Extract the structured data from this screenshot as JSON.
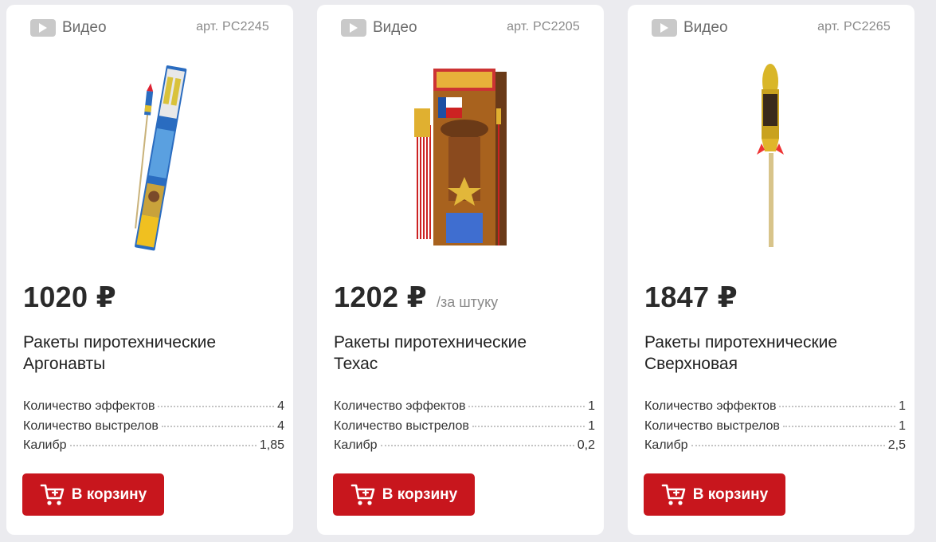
{
  "colors": {
    "background": "#ebebef",
    "card": "#ffffff",
    "cart_button": "#c8161d",
    "muted_text": "#8a8a8a"
  },
  "products": [
    {
      "video_label": "Видео",
      "article": "арт. PC2245",
      "price": "1020 ₽",
      "unit": "",
      "title_line1": "Ракеты пиротехнические",
      "title_line2": "Аргонавты",
      "specs": [
        {
          "label": "Количество эффектов",
          "value": "4"
        },
        {
          "label": "Количество выстрелов",
          "value": "4"
        },
        {
          "label": "Калибр",
          "value": "1,85"
        }
      ],
      "cart_label": "В корзину"
    },
    {
      "video_label": "Видео",
      "article": "арт. PC2205",
      "price": "1202 ₽",
      "unit": "/за штуку",
      "title_line1": "Ракеты пиротехнические",
      "title_line2": "Техас",
      "specs": [
        {
          "label": "Количество эффектов",
          "value": "1"
        },
        {
          "label": "Количество выстрелов",
          "value": "1"
        },
        {
          "label": "Калибр",
          "value": "0,2"
        }
      ],
      "cart_label": "В корзину"
    },
    {
      "video_label": "Видео",
      "article": "арт. PC2265",
      "price": "1847 ₽",
      "unit": "",
      "title_line1": "Ракеты пиротехнические",
      "title_line2": "Сверхновая",
      "specs": [
        {
          "label": "Количество эффектов",
          "value": "1"
        },
        {
          "label": "Количество выстрелов",
          "value": "1"
        },
        {
          "label": "Калибр",
          "value": "2,5"
        }
      ],
      "cart_label": "В корзину"
    }
  ]
}
